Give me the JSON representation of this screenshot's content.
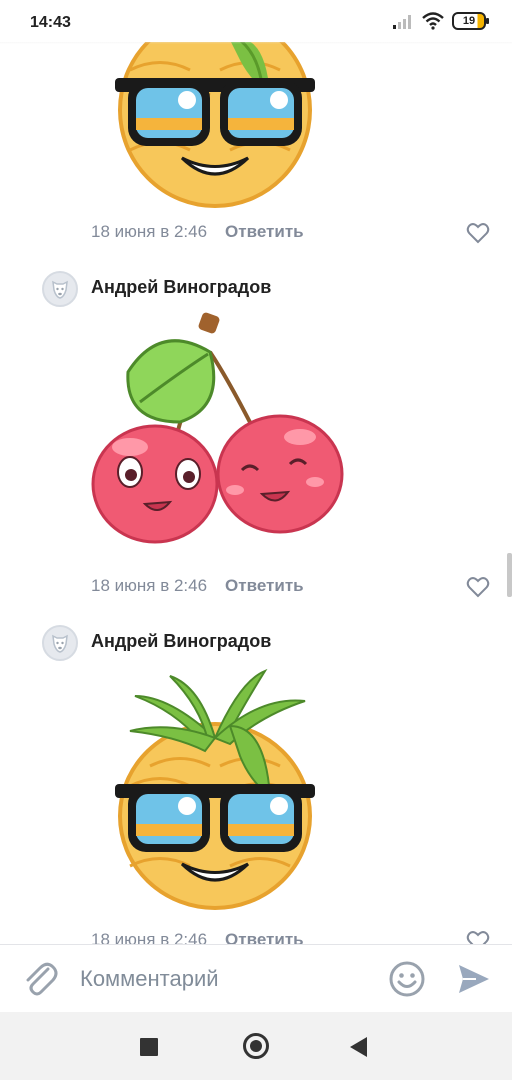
{
  "status_bar": {
    "time": "14:43",
    "battery": "19",
    "icons": [
      "signal-icon",
      "wifi-icon",
      "battery-icon"
    ]
  },
  "comments": [
    {
      "author": "",
      "sticker": "pineapple-sunglasses-sticker",
      "time": "18 июня в 2:46",
      "reply_label": "Ответить"
    },
    {
      "author": "Андрей Виноградов",
      "sticker": "cherries-sticker",
      "time": "18 июня в 2:46",
      "reply_label": "Ответить"
    },
    {
      "author": "Андрей Виноградов",
      "sticker": "pineapple-sunglasses-sticker",
      "time": "18 июня в 2:46",
      "reply_label": "Ответить"
    }
  ],
  "composer": {
    "placeholder": "Комментарий",
    "value": ""
  },
  "colors": {
    "meta_text": "#828a99",
    "placeholder": "#818c99",
    "icon_gray": "#99a2ad",
    "send_blue": "#99a8bd"
  }
}
